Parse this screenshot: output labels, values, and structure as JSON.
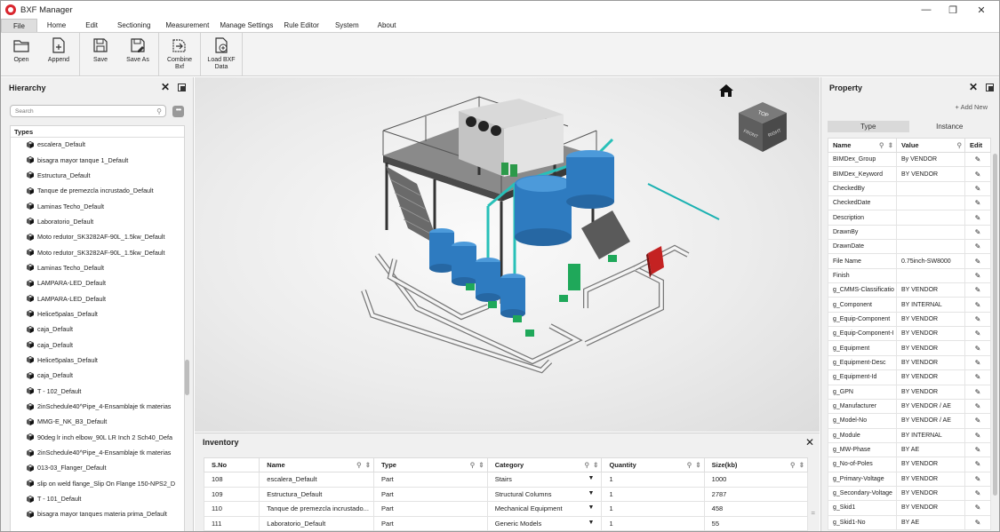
{
  "app": {
    "title": "BXF Manager",
    "brand_color": "#d9262e"
  },
  "window": {
    "minimize": "—",
    "maximize": "❐",
    "close": "✕"
  },
  "menu": [
    "File",
    "Home",
    "Edit",
    "Sectioning",
    "Measurement",
    "Manage Settings",
    "Rule Editor",
    "System",
    "About"
  ],
  "ribbon": {
    "open": "Open",
    "append": "Append",
    "save": "Save",
    "save_as": "Save As",
    "combine": "Combine Bxf",
    "load": "Load BXF Data"
  },
  "hierarchy": {
    "title": "Hierarchy",
    "search_placeholder": "Search",
    "more": "•••",
    "section": "Types",
    "items": [
      "escalera_Default",
      "bisagra mayor tanque 1_Default",
      "Estructura_Default",
      "Tanque de premezcla incrustado_Default",
      "Laminas Techo_Default",
      "Laboratorio_Default",
      "Moto redutor_SK3282AF-90L_1.5kw_Default",
      "Moto redutor_SK3282AF-90L_1.5kw_Default",
      "Laminas Techo_Default",
      "LAMPARA-LED_Default",
      "LAMPARA-LED_Default",
      "Helice5palas_Default",
      "caja_Default",
      "caja_Default",
      "Helice5palas_Default",
      "caja_Default",
      "T - 102_Default",
      "2inSchedule40^Pipe_4-Ensamblaje tk materias",
      "MMG-E_NK_B3_Default",
      "90deg lr inch elbow_90L LR Inch 2 Sch40_Defa",
      "2inSchedule40^Pipe_4-Ensamblaje tk materias",
      "013-03_Flanger_Default",
      "slip on weld flange_Slip On Flange 150-NPS2_D",
      "T - 101_Default",
      "bisagra mayor tanques materia prima_Default"
    ]
  },
  "viewcube": {
    "top": "TOP",
    "front": "FRONT",
    "right": "RIGHT"
  },
  "inventory": {
    "title": "Inventory",
    "columns": [
      "S.No",
      "Name",
      "Type",
      "Category",
      "Quantity",
      "Size(kb)"
    ],
    "rows": [
      [
        "108",
        "escalera_Default",
        "Part",
        "Stairs",
        "1",
        "1000"
      ],
      [
        "109",
        "Estructura_Default",
        "Part",
        "Structural Columns",
        "1",
        "2787"
      ],
      [
        "110",
        "Tanque de premezcla incrustado...",
        "Part",
        "Mechanical Equipment",
        "1",
        "458"
      ],
      [
        "111",
        "Laboratorio_Default",
        "Part",
        "Generic Models",
        "1",
        "55"
      ]
    ]
  },
  "property": {
    "title": "Property",
    "add_new": "+ Add New",
    "tabs": [
      "Type",
      "Instance"
    ],
    "columns": [
      "Name",
      "Value",
      "Edit"
    ],
    "rows": [
      [
        "BIMDex_Group",
        "By VENDOR"
      ],
      [
        "BIMDex_Keyword",
        "BY VENDOR"
      ],
      [
        "CheckedBy",
        ""
      ],
      [
        "CheckedDate",
        ""
      ],
      [
        "Description",
        ""
      ],
      [
        "DrawnBy",
        ""
      ],
      [
        "DrawnDate",
        ""
      ],
      [
        "File Name",
        "0.75inch-SW8000"
      ],
      [
        "Finish",
        ""
      ],
      [
        "g_CMMS-Classificatio",
        "BY VENDOR"
      ],
      [
        "g_Component",
        "BY INTERNAL"
      ],
      [
        "g_Equip-Component",
        "BY VENDOR"
      ],
      [
        "g_Equip-Component-I",
        "BY VENDOR"
      ],
      [
        "g_Equipment",
        "BY VENDOR"
      ],
      [
        "g_Equipment-Desc",
        "BY VENDOR"
      ],
      [
        "g_Equipment-Id",
        "BY VENDOR"
      ],
      [
        "g_GPN",
        "BY VENDOR"
      ],
      [
        "g_Manufacturer",
        "BY VENDOR / AE"
      ],
      [
        "g_Model-No",
        "BY VENDOR / AE"
      ],
      [
        "g_Module",
        "BY INTERNAL"
      ],
      [
        "g_MW-Phase",
        "BY AE"
      ],
      [
        "g_No-of-Poles",
        "BY VENDOR"
      ],
      [
        "g_Primary-Voltage",
        "BY VENDOR"
      ],
      [
        "g_Secondary-Voltage",
        "BY VENDOR"
      ],
      [
        "g_Skid1",
        "BY VENDOR"
      ],
      [
        "g_Skid1-No",
        "BY AE"
      ]
    ]
  }
}
